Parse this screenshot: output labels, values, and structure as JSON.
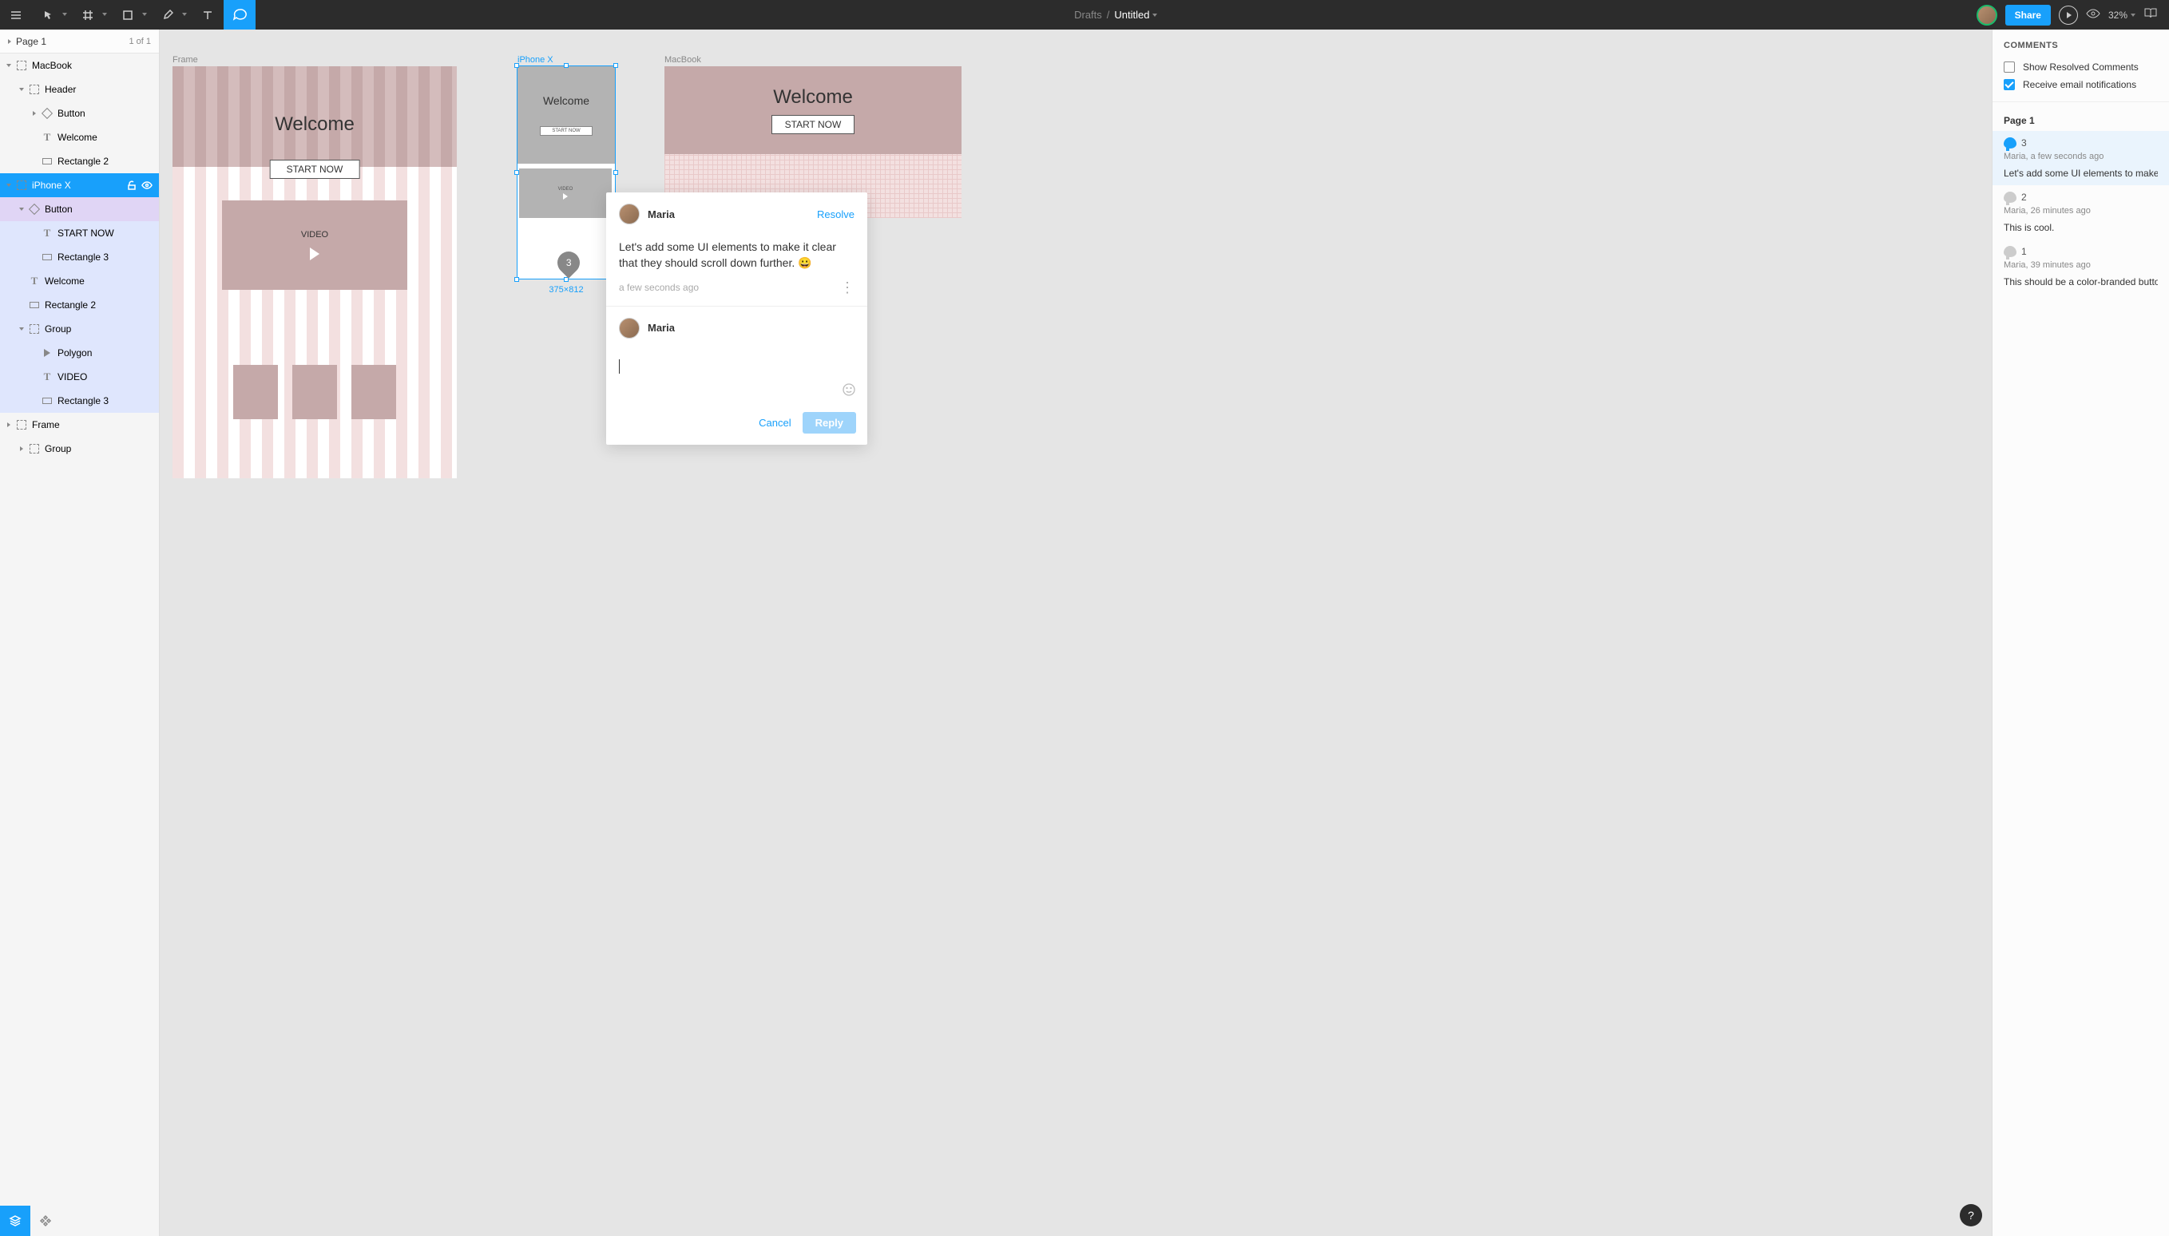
{
  "toolbar": {
    "breadcrumb": "Drafts",
    "title": "Untitled",
    "share": "Share",
    "zoom": "32%"
  },
  "pages": {
    "current": "Page 1",
    "count": "1 of 1"
  },
  "layers": [
    {
      "id": "macbook",
      "label": "MacBook",
      "depth": 0,
      "icon": "frame",
      "expand": "open"
    },
    {
      "id": "header",
      "label": "Header",
      "depth": 1,
      "icon": "frame",
      "expand": "open"
    },
    {
      "id": "button1",
      "label": "Button",
      "depth": 2,
      "icon": "diamond",
      "expand": "closed"
    },
    {
      "id": "welcome1",
      "label": "Welcome",
      "depth": 2,
      "icon": "text"
    },
    {
      "id": "rect2a",
      "label": "Rectangle 2",
      "depth": 2,
      "icon": "rect"
    },
    {
      "id": "iphonex",
      "label": "iPhone X",
      "depth": 0,
      "icon": "frame",
      "expand": "open",
      "selected": true,
      "showIcons": true
    },
    {
      "id": "button2",
      "label": "Button",
      "depth": 1,
      "icon": "diamond",
      "expand": "open",
      "purple": true
    },
    {
      "id": "startnow",
      "label": "START NOW",
      "depth": 2,
      "icon": "text",
      "within": true
    },
    {
      "id": "rect3a",
      "label": "Rectangle 3",
      "depth": 2,
      "icon": "rect",
      "within": true
    },
    {
      "id": "welcome2",
      "label": "Welcome",
      "depth": 1,
      "icon": "text",
      "within": true
    },
    {
      "id": "rect2b",
      "label": "Rectangle 2",
      "depth": 1,
      "icon": "rect",
      "within": true
    },
    {
      "id": "group1",
      "label": "Group",
      "depth": 1,
      "icon": "frame",
      "expand": "open",
      "within": true
    },
    {
      "id": "polygon",
      "label": "Polygon",
      "depth": 2,
      "icon": "poly",
      "within": true
    },
    {
      "id": "video",
      "label": "VIDEO",
      "depth": 2,
      "icon": "text",
      "within": true
    },
    {
      "id": "rect3b",
      "label": "Rectangle 3",
      "depth": 2,
      "icon": "rect",
      "within": true
    },
    {
      "id": "frame",
      "label": "Frame",
      "depth": 0,
      "icon": "frame",
      "expand": "closed"
    },
    {
      "id": "group2",
      "label": "Group",
      "depth": 1,
      "icon": "frame",
      "expand": "closed"
    }
  ],
  "canvas": {
    "frames": [
      {
        "id": "frame1",
        "label": "Frame"
      },
      {
        "id": "iphonex",
        "label": "iPhone X",
        "selected": true,
        "dim": "375×812"
      },
      {
        "id": "macbook",
        "label": "MacBook"
      }
    ],
    "welcome": "Welcome",
    "startNow": "START NOW",
    "video": "VIDEO",
    "commentPin": "3"
  },
  "commentPopup": {
    "author": "Maria",
    "resolve": "Resolve",
    "body": "Let's add some UI elements to make it clear that they should scroll down further. 😀",
    "meta": "a few seconds ago",
    "replyAuthor": "Maria",
    "cancel": "Cancel",
    "reply": "Reply"
  },
  "rightPanel": {
    "title": "COMMENTS",
    "showResolved": "Show Resolved Comments",
    "emailNotif": "Receive email notifications",
    "section": "Page 1",
    "comments": [
      {
        "num": "3",
        "sub": "Maria, a few seconds ago",
        "txt": "Let's add some UI elements to make it",
        "active": true
      },
      {
        "num": "2",
        "sub": "Maria, 26 minutes ago",
        "txt": "This is cool."
      },
      {
        "num": "1",
        "sub": "Maria, 39 minutes ago",
        "txt": "This should be a color-branded button"
      }
    ]
  },
  "help": "?"
}
